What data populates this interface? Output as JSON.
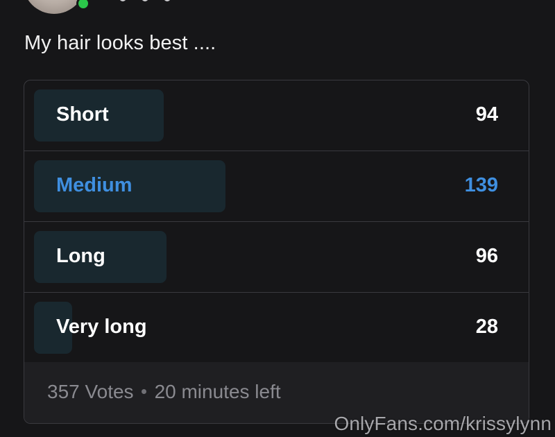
{
  "post": {
    "text": "My hair looks best ...."
  },
  "poll": {
    "options": [
      {
        "label": "Short",
        "votes": "94",
        "share": 0.263,
        "selected": false
      },
      {
        "label": "Medium",
        "votes": "139",
        "share": 0.389,
        "selected": true
      },
      {
        "label": "Long",
        "votes": "96",
        "share": 0.269,
        "selected": false
      },
      {
        "label": "Very long",
        "votes": "28",
        "share": 0.078,
        "selected": false
      }
    ],
    "votes_text": "357 Votes",
    "time_left_text": "20 minutes left"
  },
  "watermark": "OnlyFans.com/krissylynn",
  "colors": {
    "background": "#161618",
    "fill": "#19282f",
    "selected_accent": "#3f8fe0",
    "online": "#2bc64a"
  }
}
